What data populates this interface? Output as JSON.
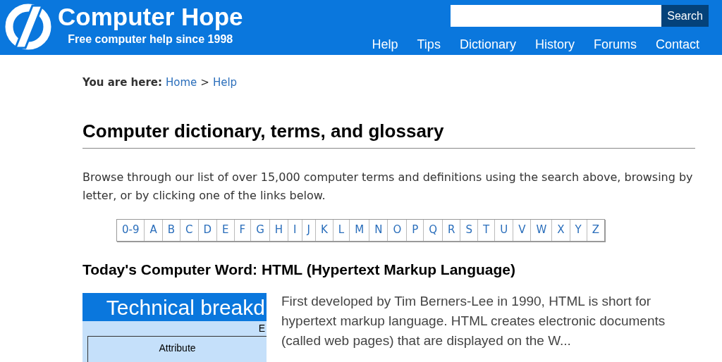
{
  "header": {
    "logo_title": "Computer Hope",
    "tagline": "Free computer help since 1998",
    "search": {
      "button": "Search"
    },
    "nav": [
      "Help",
      "Tips",
      "Dictionary",
      "History",
      "Forums",
      "Contact"
    ]
  },
  "breadcrumb": {
    "label": "You are here:",
    "links": [
      "Home",
      "Help"
    ],
    "separator": ">"
  },
  "title": "Computer dictionary, terms, and glossary",
  "intro": "Browse through our list of over 15,000 computer terms and definitions using the search above, browsing by letter, or by clicking one of the links below.",
  "letters": [
    "0-9",
    "A",
    "B",
    "C",
    "D",
    "E",
    "F",
    "G",
    "H",
    "I",
    "J",
    "K",
    "L",
    "M",
    "N",
    "O",
    "P",
    "Q",
    "R",
    "S",
    "T",
    "U",
    "V",
    "W",
    "X",
    "Y",
    "Z"
  ],
  "word_of_day": {
    "heading": "Today's Computer Word: HTML (Hypertext Markup Language)",
    "image": {
      "title": "Technical breakd",
      "subtitle": "E",
      "box_label": "Attribute"
    },
    "text": "First developed by Tim Berners-Lee in 1990, HTML is short for hypertext markup language. HTML creates electronic documents (called web pages) that are displayed on the W..."
  }
}
